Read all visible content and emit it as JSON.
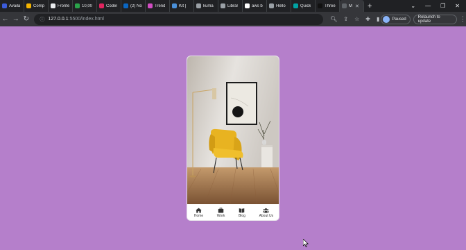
{
  "browser": {
    "tabs": [
      {
        "label": "Availa",
        "color": "#3b5bdb"
      },
      {
        "label": "Comp",
        "color": "#f4b400"
      },
      {
        "label": "Fronte",
        "color": "#e8eaed"
      },
      {
        "label": "10,00",
        "color": "#2aa34a"
      },
      {
        "label": "Coder",
        "color": "#e0245e"
      },
      {
        "label": "(2) No",
        "color": "#0a66c2"
      },
      {
        "label": "Trend",
        "color": "#d24dc3"
      },
      {
        "label": "Kit |",
        "color": "#4a90d9"
      },
      {
        "label": "kuma",
        "color": "#9aa0a6"
      },
      {
        "label": "Librar",
        "color": "#9aa0a6"
      },
      {
        "label": "aws b",
        "color": "#ffffff"
      },
      {
        "label": "Hello",
        "color": "#9aa0a6"
      },
      {
        "label": "Quick",
        "color": "#00a3a3"
      },
      {
        "label": "Three",
        "color": "#111111"
      },
      {
        "label": "M",
        "color": "#5f6368"
      }
    ],
    "new_tab": "+",
    "window_controls": [
      "⌄",
      "—",
      "❐",
      "✕"
    ],
    "url_host": "127.0.0.1",
    "url_path": ":5500/index.html",
    "paused_label": "Paused",
    "relaunch_label": "Relaunch to update"
  },
  "nav": {
    "items": [
      {
        "label": "Home",
        "icon": "home-icon"
      },
      {
        "label": "Work",
        "icon": "briefcase-icon"
      },
      {
        "label": "Blog",
        "icon": "book-icon"
      },
      {
        "label": "About Us",
        "icon": "users-icon"
      }
    ]
  },
  "colors": {
    "page_bg": "#b57fcb",
    "chair": "#e8b321",
    "floor": "#a87a4e"
  }
}
